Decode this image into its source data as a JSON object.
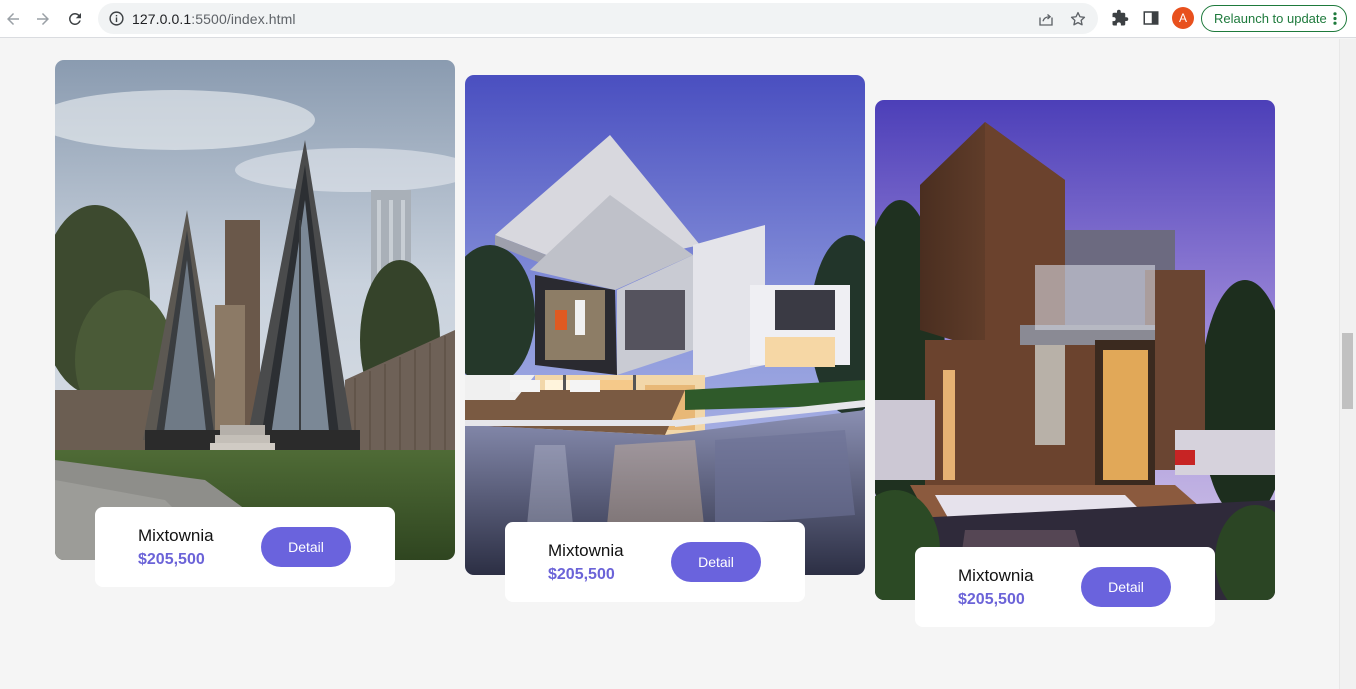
{
  "browser": {
    "url_host": "127.0.0.1",
    "url_rest": ":5500/index.html",
    "avatar_letter": "A",
    "relaunch_label": "Relaunch to update",
    "accent_color": "#1e7a3c"
  },
  "listings": [
    {
      "name": "Mixtownia",
      "price": "$205,500",
      "button_label": "Detail"
    },
    {
      "name": "Mixtownia",
      "price": "$205,500",
      "button_label": "Detail"
    },
    {
      "name": "Mixtownia",
      "price": "$205,500",
      "button_label": "Detail"
    }
  ],
  "colors": {
    "primary": "#6a63dd",
    "price": "#6b63d8",
    "background": "#f5f5f5"
  }
}
